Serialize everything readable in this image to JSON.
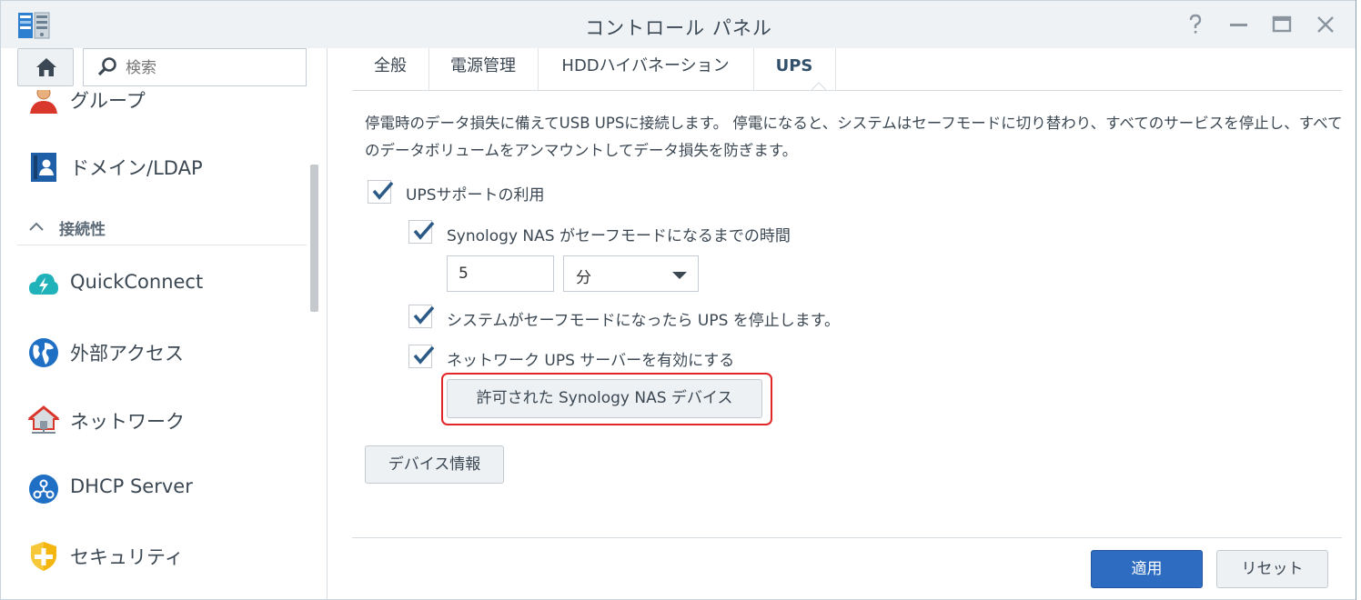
{
  "window": {
    "title": "コントロール パネル",
    "help_icon": "help-icon",
    "minimize_icon": "minimize-icon",
    "maximize_icon": "maximize-icon",
    "close_icon": "close-icon"
  },
  "sidebar": {
    "search_placeholder": "検索",
    "items_top": [
      {
        "label": "グループ",
        "icon": "group-icon"
      },
      {
        "label": "ドメイン/LDAP",
        "icon": "domain-ldap-icon"
      }
    ],
    "section": {
      "label": "接続性",
      "icon": "chevron-up-icon"
    },
    "items": [
      {
        "label": "QuickConnect",
        "icon": "quickconnect-icon"
      },
      {
        "label": "外部アクセス",
        "icon": "globe-icon"
      },
      {
        "label": "ネットワーク",
        "icon": "network-house-icon"
      },
      {
        "label": "DHCP Server",
        "icon": "dhcp-icon"
      },
      {
        "label": "セキュリティ",
        "icon": "shield-icon"
      }
    ]
  },
  "tabs": [
    {
      "label": "全般",
      "active": false
    },
    {
      "label": "電源管理",
      "active": false
    },
    {
      "label": "HDDハイバネーション",
      "active": false
    },
    {
      "label": "UPS",
      "active": true
    }
  ],
  "ups": {
    "description": "停電時のデータ損失に備えてUSB UPSに接続します。 停電になると、システムはセーフモードに切り替わり、すべてのサービスを停止し、すべてのデータボリュームをアンマウントしてデータ損失を防ぎます。",
    "enable_label": "UPSサポートの利用",
    "enable_checked": true,
    "safe_mode_time_label": "Synology NAS がセーフモードになるまでの時間",
    "safe_mode_time_checked": true,
    "time_value": "5",
    "time_unit": "分",
    "stop_ups_label": "システムがセーフモードになったら UPS を停止します。",
    "stop_ups_checked": true,
    "network_server_label": "ネットワーク UPS サーバーを有効にする",
    "network_server_checked": true,
    "permitted_devices_button": "許可された Synology NAS デバイス",
    "device_info_button": "デバイス情報"
  },
  "footer": {
    "apply_label": "適用",
    "reset_label": "リセット"
  },
  "colors": {
    "primary_button": "#2d6cc0",
    "checkmark": "#2c5a86",
    "highlight_border": "#e2262a"
  }
}
